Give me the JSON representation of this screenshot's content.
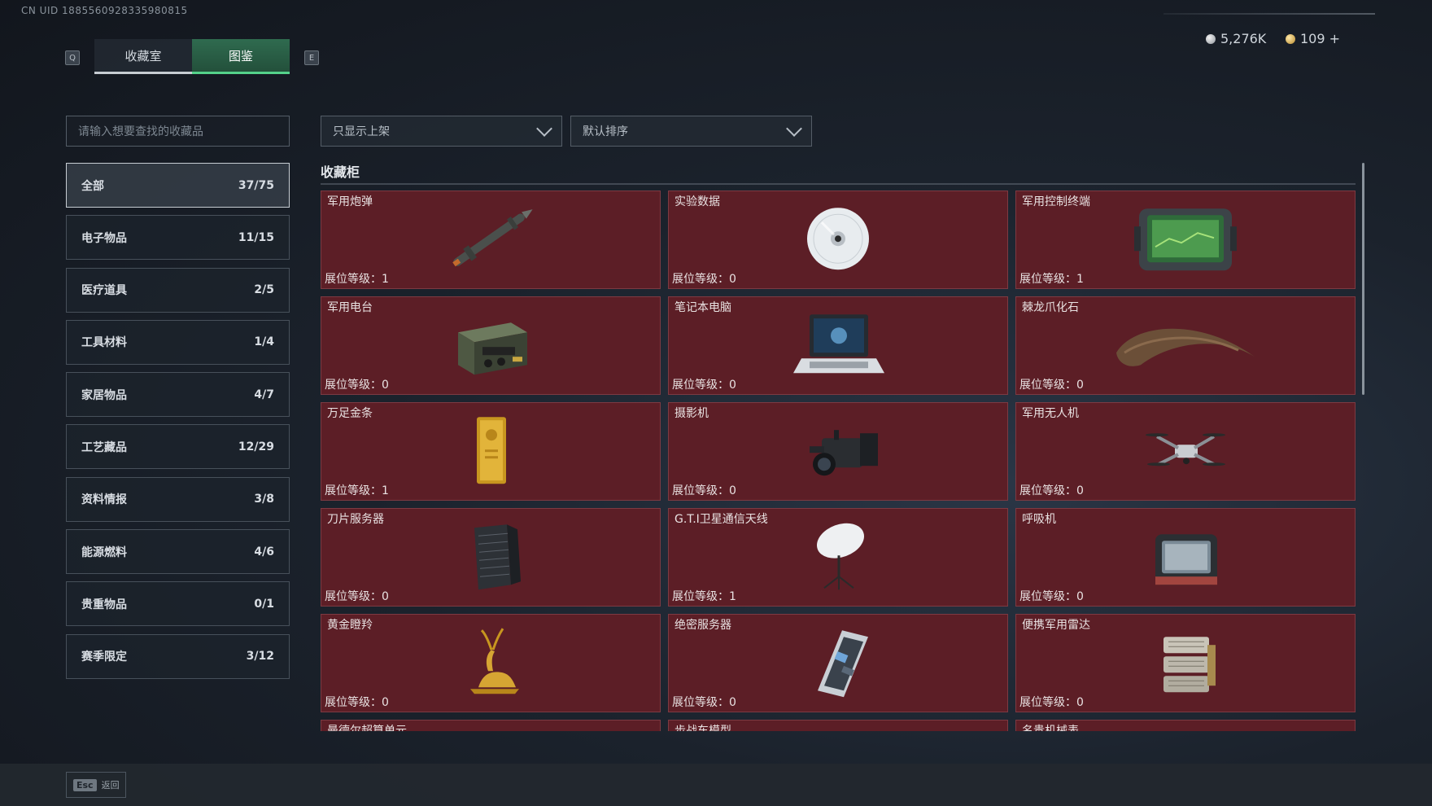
{
  "uid": "CN UID 1885560928335980815",
  "currency": {
    "silver": "5,276K",
    "gold": "109 +"
  },
  "keys": {
    "left": "Q",
    "right": "E"
  },
  "tabs": [
    {
      "label": "收藏室"
    },
    {
      "label": "图鉴"
    }
  ],
  "search": {
    "placeholder": "请输入想要查找的收藏品"
  },
  "filters": {
    "display": "只显示上架",
    "sort": "默认排序"
  },
  "categories": [
    {
      "label": "全部",
      "count": "37/75"
    },
    {
      "label": "电子物品",
      "count": "11/15"
    },
    {
      "label": "医疗道具",
      "count": "2/5"
    },
    {
      "label": "工具材料",
      "count": "1/4"
    },
    {
      "label": "家居物品",
      "count": "4/7"
    },
    {
      "label": "工艺藏品",
      "count": "12/29"
    },
    {
      "label": "资料情报",
      "count": "3/8"
    },
    {
      "label": "能源燃料",
      "count": "4/6"
    },
    {
      "label": "贵重物品",
      "count": "0/1"
    },
    {
      "label": "赛季限定",
      "count": "3/12"
    }
  ],
  "section_title": "收藏柜",
  "level_label": "展位等级：",
  "items": [
    {
      "name": "军用炮弹",
      "level": "1",
      "icon": "missile-icon"
    },
    {
      "name": "实验数据",
      "level": "0",
      "icon": "disc-icon"
    },
    {
      "name": "军用控制终端",
      "level": "1",
      "icon": "control-terminal-icon"
    },
    {
      "name": "军用电台",
      "level": "0",
      "icon": "radio-icon"
    },
    {
      "name": "笔记本电脑",
      "level": "0",
      "icon": "laptop-icon"
    },
    {
      "name": "棘龙爪化石",
      "level": "0",
      "icon": "claw-fossil-icon"
    },
    {
      "name": "万足金条",
      "level": "1",
      "icon": "gold-bar-icon"
    },
    {
      "name": "摄影机",
      "level": "0",
      "icon": "camera-icon"
    },
    {
      "name": "军用无人机",
      "level": "0",
      "icon": "drone-icon"
    },
    {
      "name": "刀片服务器",
      "level": "0",
      "icon": "blade-server-icon"
    },
    {
      "name": "G.T.I卫星通信天线",
      "level": "1",
      "icon": "satellite-dish-icon"
    },
    {
      "name": "呼吸机",
      "level": "0",
      "icon": "ventilator-icon"
    },
    {
      "name": "黄金瞪羚",
      "level": "0",
      "icon": "golden-gazelle-icon"
    },
    {
      "name": "绝密服务器",
      "level": "0",
      "icon": "secret-server-icon"
    },
    {
      "name": "便携军用雷达",
      "level": "0",
      "icon": "radar-icon"
    },
    {
      "name": "曼德尔超算单元",
      "level": "",
      "icon": ""
    },
    {
      "name": "步战车模型",
      "level": "",
      "icon": ""
    },
    {
      "name": "名贵机械表",
      "level": "",
      "icon": ""
    }
  ],
  "footer": {
    "esc_key": "Esc",
    "esc_label": "返回"
  }
}
